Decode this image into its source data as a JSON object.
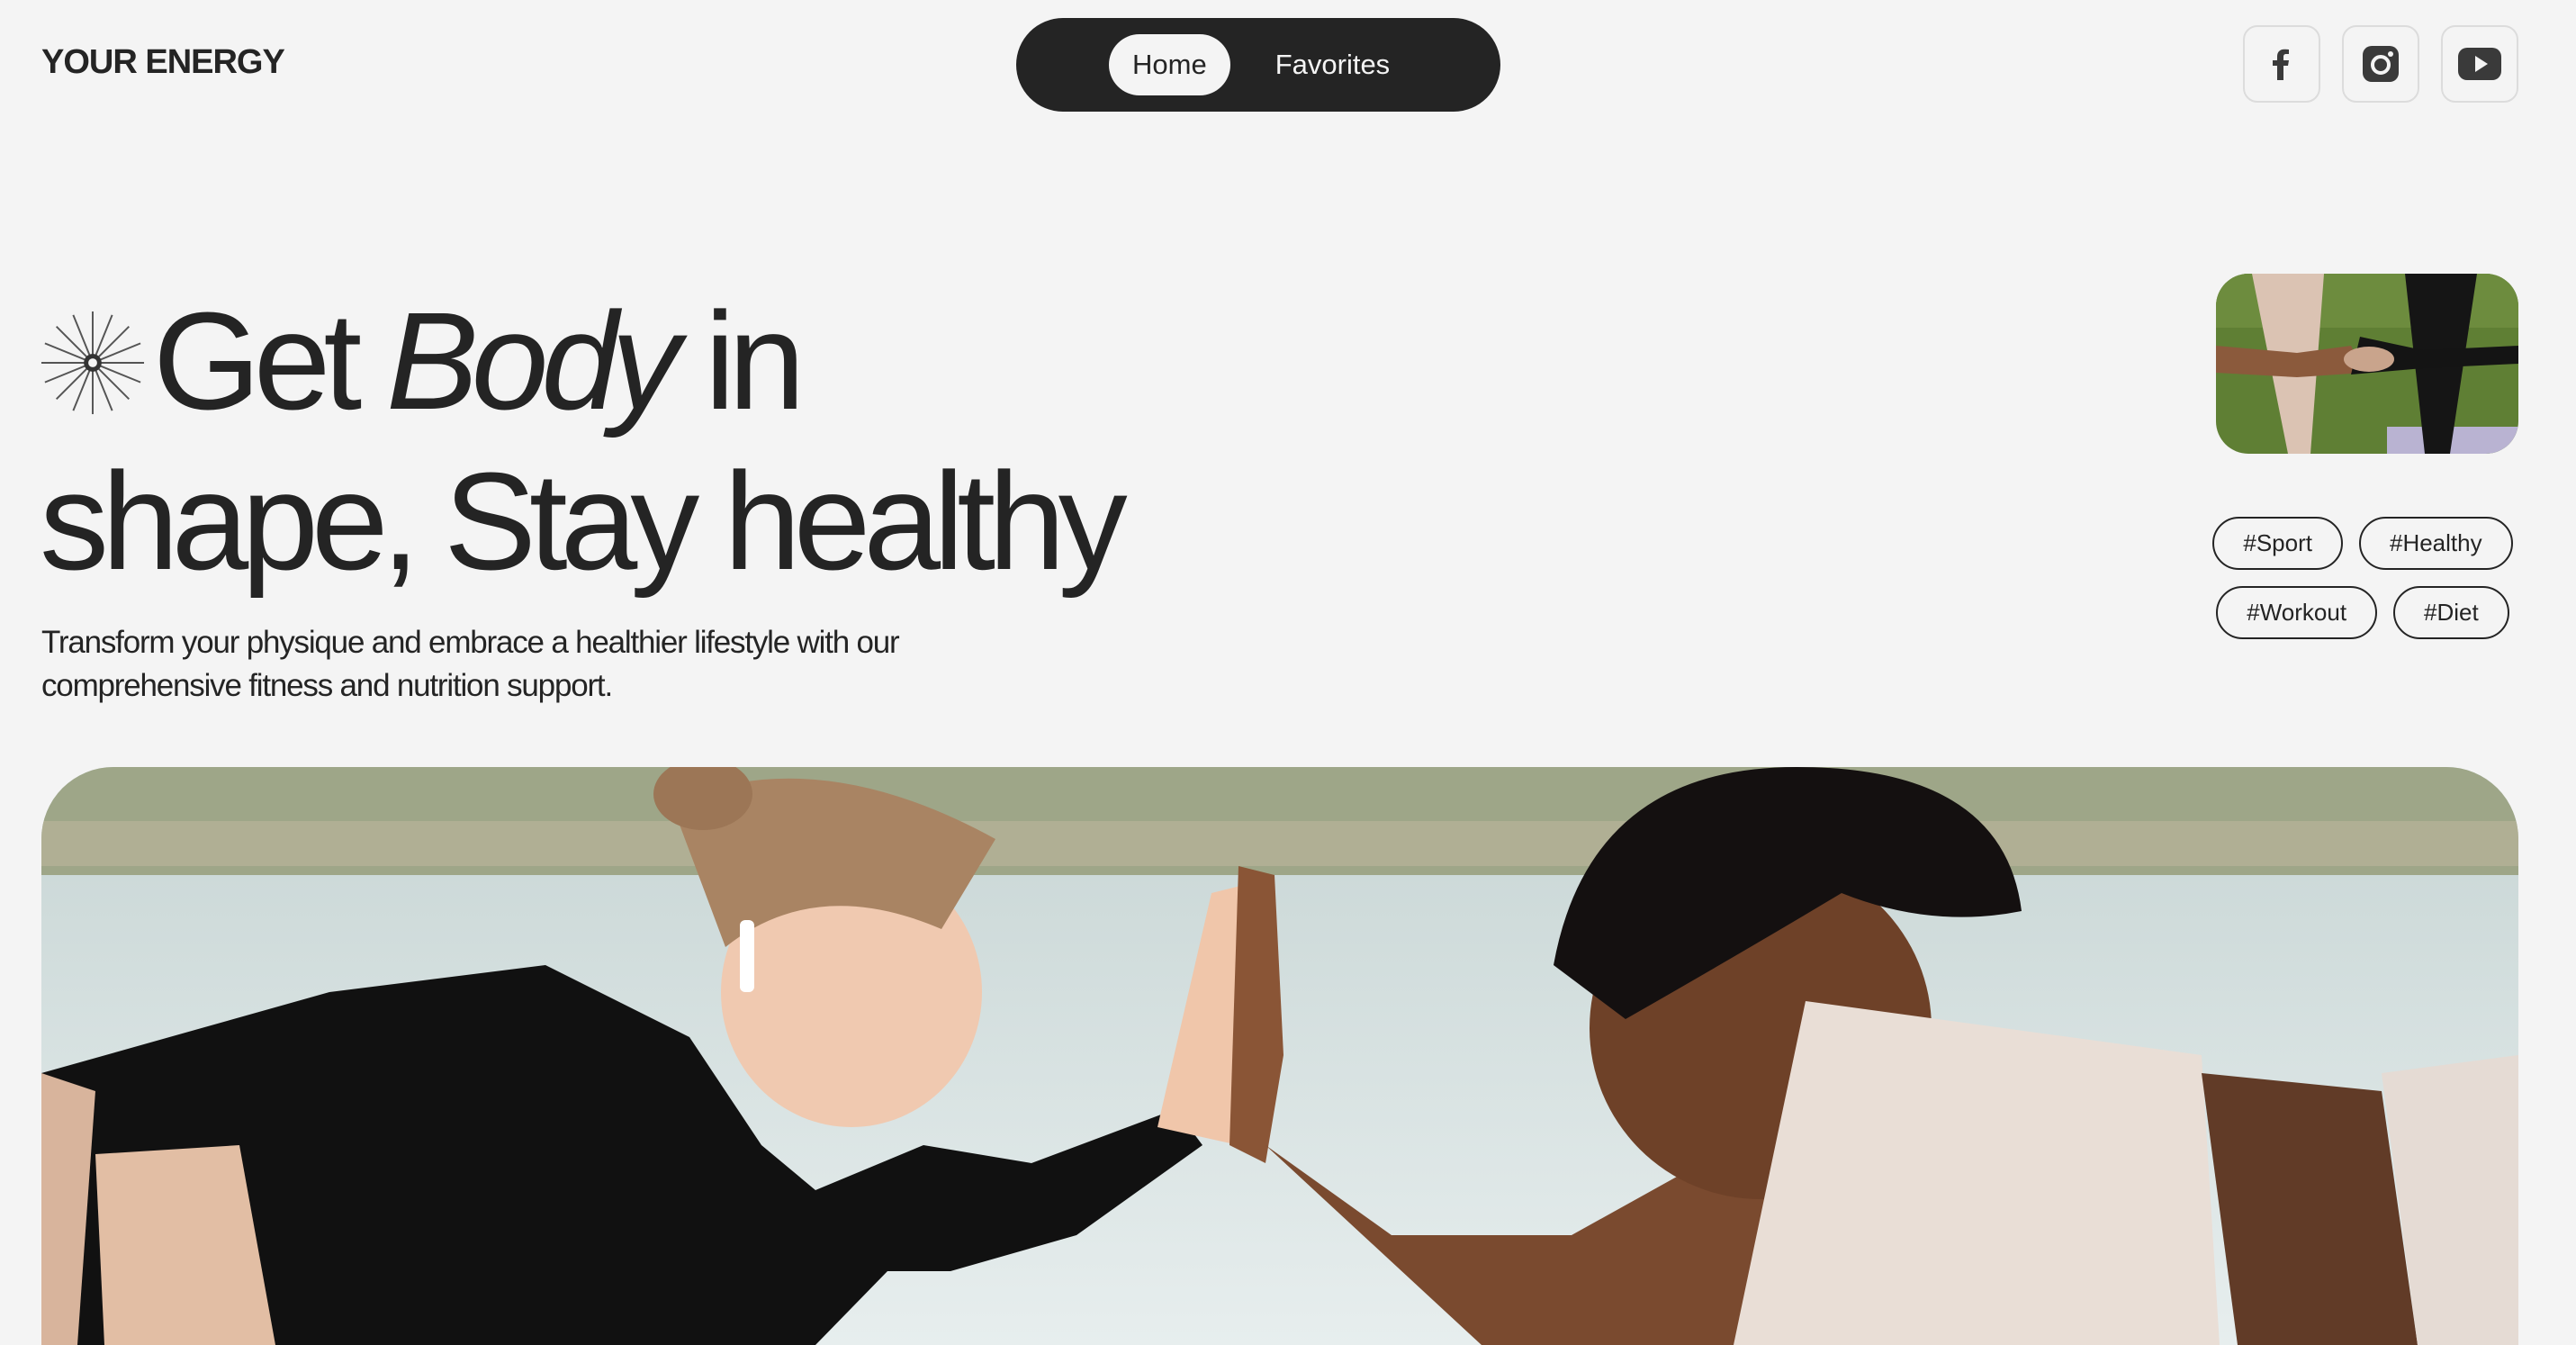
{
  "header": {
    "logo": "YOUR ENERGY",
    "nav": [
      {
        "label": "Home",
        "active": true
      },
      {
        "label": "Favorites",
        "active": false
      }
    ],
    "socials": [
      "facebook-icon",
      "instagram-icon",
      "youtube-icon"
    ]
  },
  "hero": {
    "title_part1": "Get",
    "title_italic": "Body",
    "title_part2": "in",
    "title_line2": "shape, Stay healthy",
    "subtitle": "Transform your physique and embrace a healthier lifestyle with our comprehensive fitness and nutrition support.",
    "tags": [
      "#Sport",
      "#Healthy",
      "#Workout",
      "#Diet"
    ]
  },
  "colors": {
    "background": "#f4f4f4",
    "text": "#242424",
    "nav_bg": "#242424"
  }
}
